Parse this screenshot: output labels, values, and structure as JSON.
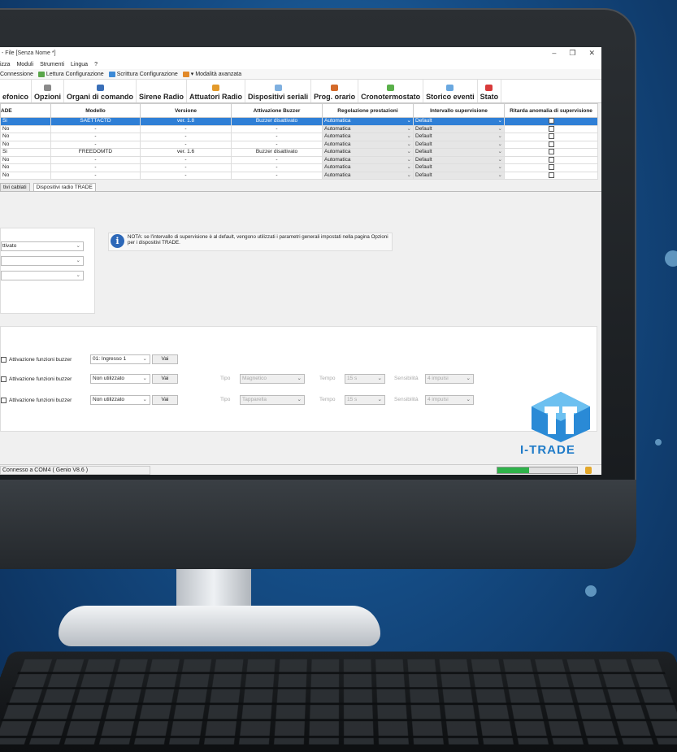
{
  "window": {
    "title": "- File [Senza Nome *]",
    "controls": [
      "–",
      "❐",
      "✕"
    ]
  },
  "menu": [
    "izza",
    "Moduli",
    "Strumenti",
    "Lingua",
    "?"
  ],
  "toolbar": {
    "connection": "Connessione",
    "read_config": "Lettura Configurazione",
    "write_config": "Scrittura Configurazione",
    "advanced_mode": "Modalità avanzata"
  },
  "ribbon": [
    "efonico",
    "Opzioni",
    "Organi di comando",
    "Sirene Radio",
    "Attuatori Radio",
    "Dispositivi seriali",
    "Prog. orario",
    "Cronotermostato",
    "Storico eventi",
    "Stato"
  ],
  "table": {
    "headers": [
      "ADE",
      "Modello",
      "Versione",
      "Attivazione Buzzer",
      "Regolazione prestazioni",
      "Intervallo supervisione",
      "Ritarda anomalia di supervisione"
    ],
    "rows": [
      {
        "ade": "Si",
        "modello": "SAETTACTD",
        "versione": "ver. 1.8",
        "buzzer": "Buzzer disattivato",
        "regolazione": "Automatica",
        "intervallo": "Default"
      },
      {
        "ade": "No",
        "modello": "-",
        "versione": "-",
        "buzzer": "-",
        "regolazione": "Automatica",
        "intervallo": "Default"
      },
      {
        "ade": "No",
        "modello": "-",
        "versione": "-",
        "buzzer": "-",
        "regolazione": "Automatica",
        "intervallo": "Default"
      },
      {
        "ade": "No",
        "modello": "-",
        "versione": "-",
        "buzzer": "-",
        "regolazione": "Automatica",
        "intervallo": "Default"
      },
      {
        "ade": "Si",
        "modello": "FREEDOMTD",
        "versione": "ver. 1.6",
        "buzzer": "Buzzer disattivato",
        "regolazione": "Automatica",
        "intervallo": "Default"
      },
      {
        "ade": "No",
        "modello": "-",
        "versione": "-",
        "buzzer": "-",
        "regolazione": "Automatica",
        "intervallo": "Default"
      },
      {
        "ade": "No",
        "modello": "-",
        "versione": "-",
        "buzzer": "-",
        "regolazione": "Automatica",
        "intervallo": "Default"
      },
      {
        "ade": "No",
        "modello": "-",
        "versione": "-",
        "buzzer": "-",
        "regolazione": "Automatica",
        "intervallo": "Default"
      }
    ]
  },
  "tabs": [
    "tivi cablati",
    "Dispositivi radio TRADE"
  ],
  "left_panel": {
    "select1": "ttivato"
  },
  "note": {
    "text": "NOTA: se l'intervallo di supervisione è al default, vengono utilizzati i parametri generali impostati nella pagina Opzioni per i dispositivi TRADE."
  },
  "buzzer_rows": [
    {
      "label": "Attivazione funzioni buzzer",
      "select": "01: Ingresso 1",
      "button": "Vai"
    },
    {
      "label": "Attivazione funzioni buzzer",
      "select": "Non utilizzato",
      "button": "Vai",
      "tipo_label": "Tipo",
      "tipo": "Magnetico",
      "tempo_label": "Tempo",
      "tempo": "15 s",
      "sens_label": "Sensibilità",
      "sens": "4 impulsi"
    },
    {
      "label": "Attivazione funzioni buzzer",
      "select": "Non utilizzato",
      "button": "Vai",
      "tipo_label": "Tipo",
      "tipo": "Tapparella",
      "tempo_label": "Tempo",
      "tempo": "15 s",
      "sens_label": "Sensibilità",
      "sens": "4 impulsi"
    }
  ],
  "logo": {
    "text": "I-TRADE"
  },
  "status": {
    "text": "Connesso a COM4 (  Genio  V8.6 )",
    "progress": 0.4
  }
}
